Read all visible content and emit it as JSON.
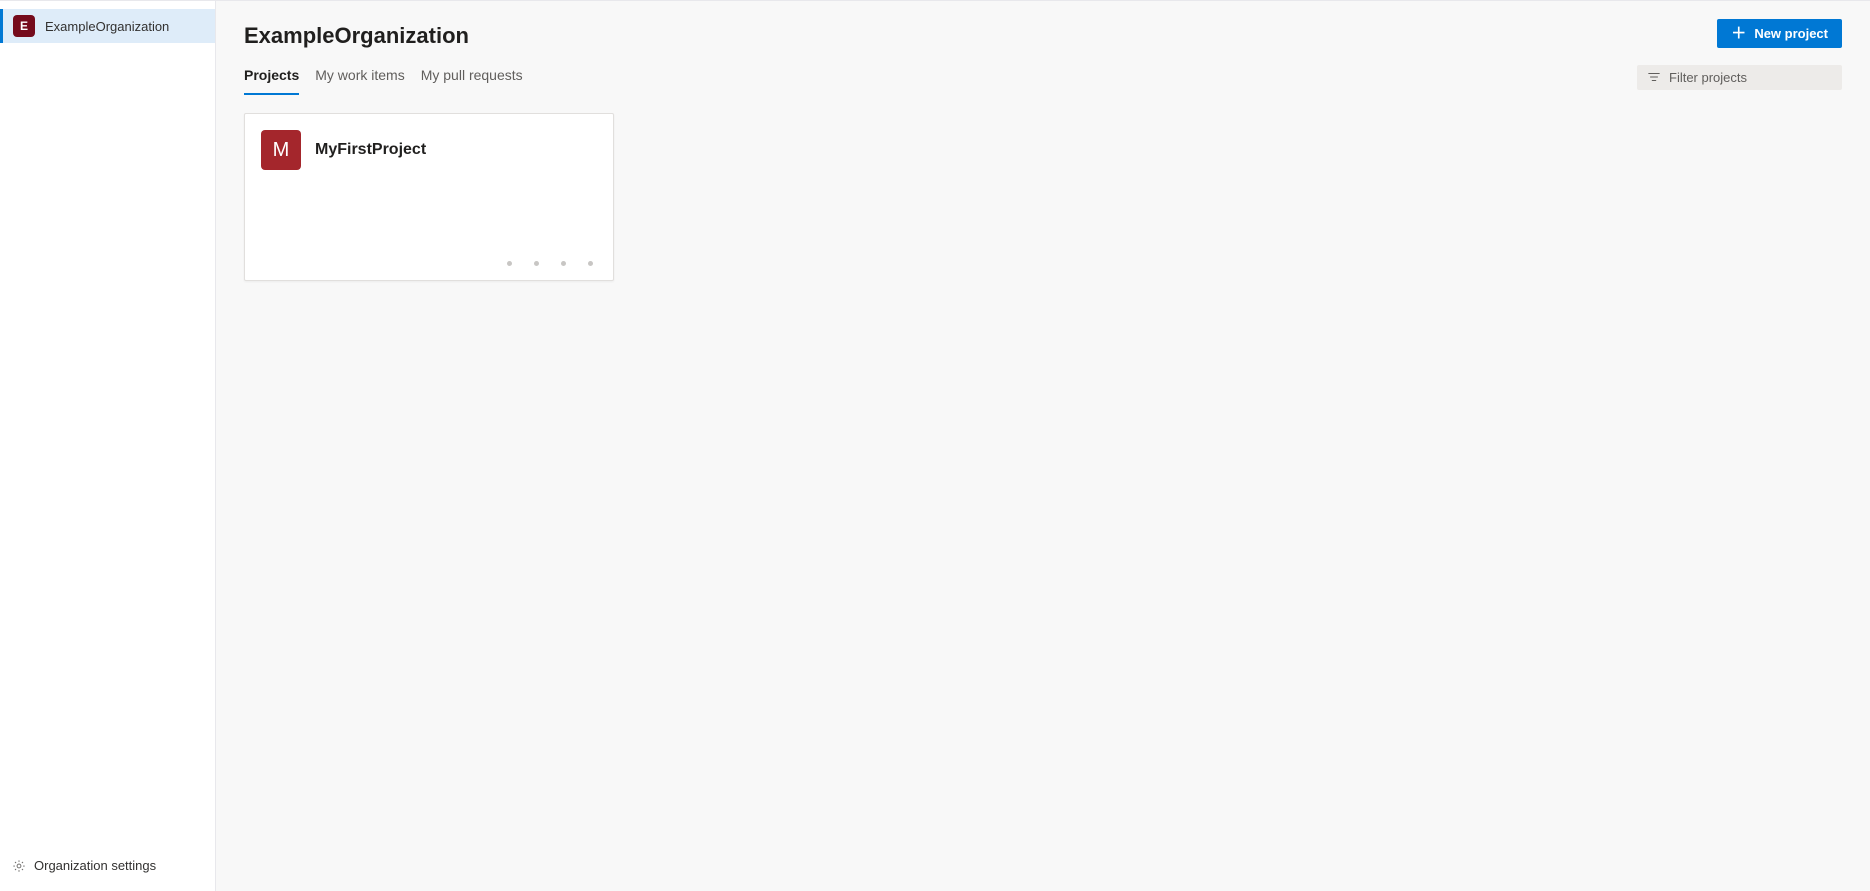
{
  "sidebar": {
    "org_badge_letter": "E",
    "org_label": "ExampleOrganization",
    "settings_label": "Organization settings"
  },
  "header": {
    "title": "ExampleOrganization",
    "new_project_label": "New project"
  },
  "tabs": [
    {
      "label": "Projects",
      "active": true
    },
    {
      "label": "My work items",
      "active": false
    },
    {
      "label": "My pull requests",
      "active": false
    }
  ],
  "filter": {
    "placeholder": "Filter projects"
  },
  "projects": [
    {
      "badge_letter": "M",
      "name": "MyFirstProject",
      "badge_color": "#a4262c"
    }
  ]
}
